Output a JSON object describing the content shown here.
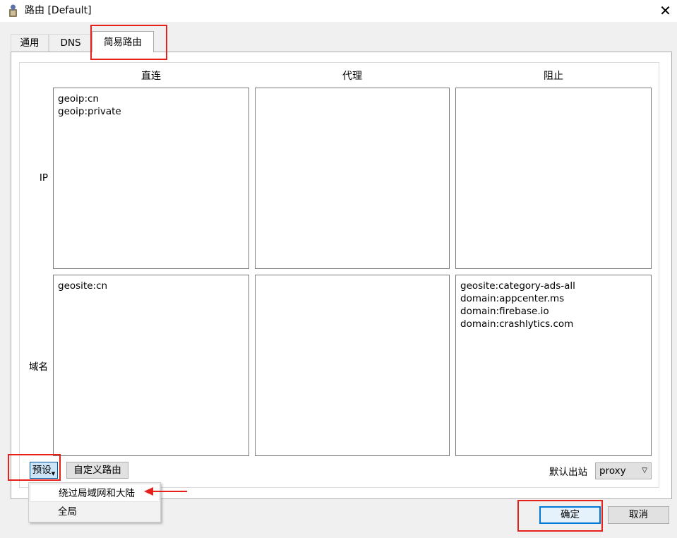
{
  "window": {
    "title": "路由 [Default]",
    "close_glyph": "✕"
  },
  "tabs": [
    {
      "label": "通用",
      "active": false
    },
    {
      "label": "DNS",
      "active": false
    },
    {
      "label": "简易路由",
      "active": true
    }
  ],
  "columns": {
    "direct": "直连",
    "proxy": "代理",
    "block": "阻止"
  },
  "rows": {
    "ip": "IP",
    "domain": "域名"
  },
  "rules": {
    "ip_direct": [
      "geoip:cn",
      "geoip:private"
    ],
    "ip_proxy": [],
    "ip_block": [],
    "domain_direct": [
      "geosite:cn"
    ],
    "domain_proxy": [],
    "domain_block": [
      "geosite:category-ads-all",
      "domain:appcenter.ms",
      "domain:firebase.io",
      "domain:crashlytics.com"
    ]
  },
  "buttons": {
    "preset": "预设",
    "custom_routing": "自定义路由",
    "ok": "确定",
    "cancel": "取消"
  },
  "default_outbound": {
    "label": "默认出站",
    "value": "proxy"
  },
  "preset_menu": {
    "items": [
      "绕过局域网和大陆",
      "全局"
    ]
  },
  "colors": {
    "annotation": "#e8201a",
    "focus": "#0078d7"
  },
  "icons": {
    "app": "app-icon",
    "close": "close-icon",
    "dropdown": "chevron-down-icon"
  }
}
